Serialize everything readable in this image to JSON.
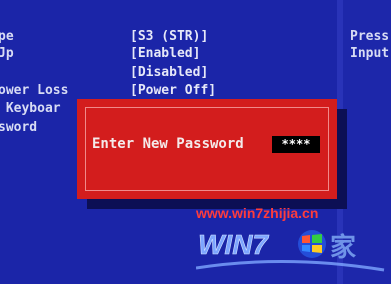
{
  "settings": {
    "labels": [
      "pe",
      "Jp",
      "",
      "ower Loss",
      " Keyboar",
      "sword"
    ],
    "values": [
      "[S3 (STR)]",
      "[Enabled]",
      "[Disabled]",
      "[Power Off]"
    ]
  },
  "help": [
    "Press",
    "Input"
  ],
  "dialog": {
    "prompt": "Enter New Password",
    "password_mask": "****"
  },
  "watermark": {
    "url": "www.win7zhijia.cn",
    "logo_text": "WIN7",
    "logo_suffix": "家"
  }
}
